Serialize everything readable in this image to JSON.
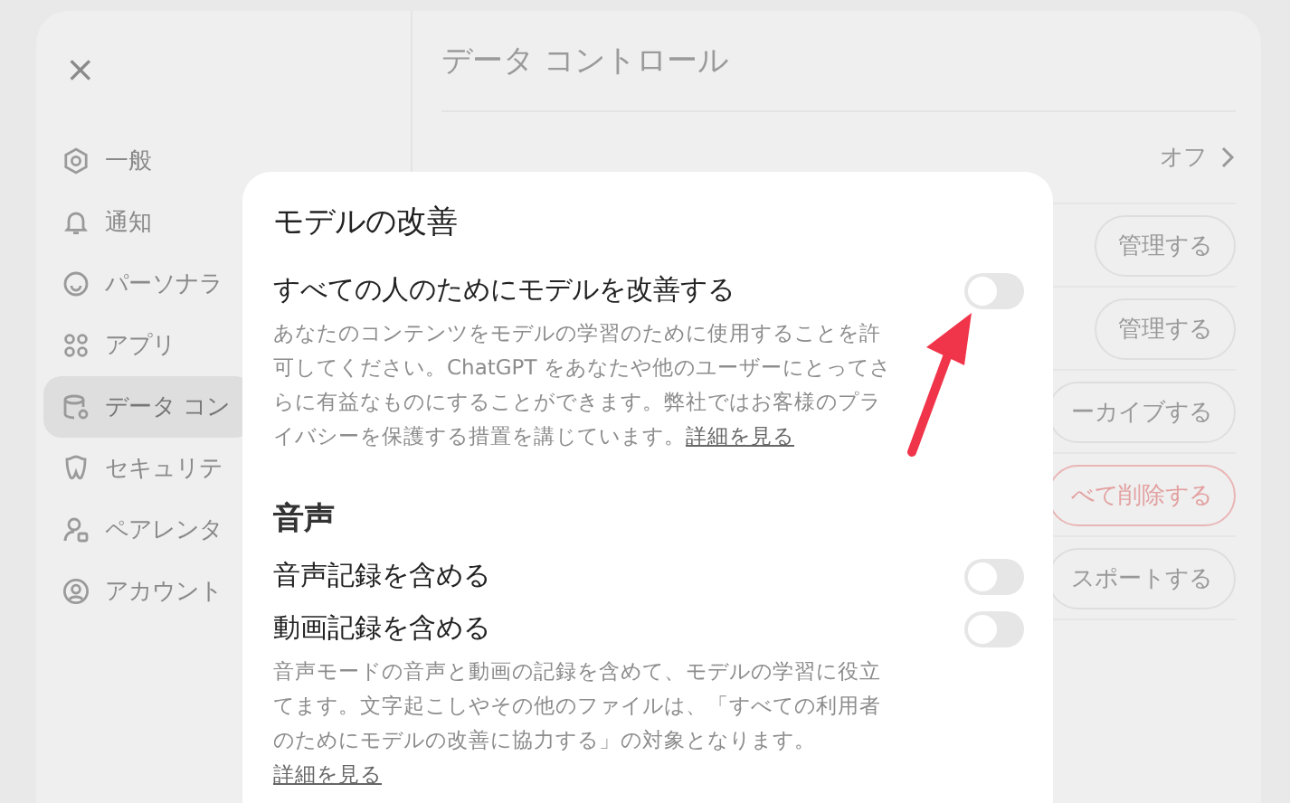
{
  "settings": {
    "close": "×",
    "title": "データ コントロール",
    "sidebar": {
      "items": [
        {
          "label": "一般",
          "selected": false
        },
        {
          "label": "通知",
          "selected": false
        },
        {
          "label": "パーソナラ",
          "selected": false
        },
        {
          "label": "アプリ",
          "selected": false
        },
        {
          "label": "データ コン",
          "selected": true
        },
        {
          "label": "セキュリテ",
          "selected": false
        },
        {
          "label": "ペアレンタ",
          "selected": false
        },
        {
          "label": "アカウント",
          "selected": false
        }
      ]
    },
    "rows": [
      {
        "kind": "value",
        "value": "オフ"
      },
      {
        "kind": "button",
        "button": "管理する",
        "danger": false
      },
      {
        "kind": "button",
        "button": "管理する",
        "danger": false
      },
      {
        "kind": "button",
        "button": "ーカイブする",
        "danger": false
      },
      {
        "kind": "button",
        "button": "べて削除する",
        "danger": true
      },
      {
        "kind": "button",
        "button": "スポートする",
        "danger": false
      }
    ]
  },
  "dialog": {
    "title": "モデルの改善",
    "sections": [
      {
        "toggles": [
          {
            "label": "すべての人のためにモデルを改善する",
            "on": false
          }
        ],
        "description": "あなたのコンテンツをモデルの学習のために使用することを許可してください。ChatGPT をあなたや他のユーザーにとってさらに有益なものにすることができます。弊社ではお客様のプライバシーを保護する措置を講じています。",
        "link": "詳細を見る"
      },
      {
        "heading": "音声",
        "toggles": [
          {
            "label": "音声記録を含める",
            "on": false
          },
          {
            "label": "動画記録を含める",
            "on": false
          }
        ],
        "description": "音声モードの音声と動画の記録を含めて、モデルの学習に役立てます。文字起こしやその他のファイルは、「すべての利用者のためにモデルの改善に協力する」の対象となります。",
        "link": "詳細を見る"
      }
    ]
  }
}
